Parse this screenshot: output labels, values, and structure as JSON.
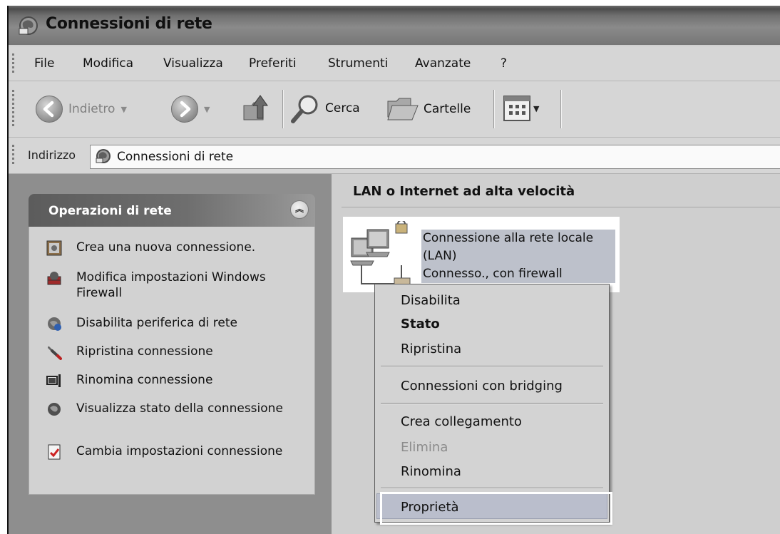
{
  "window": {
    "title": "Connessioni di rete"
  },
  "menubar": {
    "items": [
      "File",
      "Modifica",
      "Visualizza",
      "Preferiti",
      "Strumenti",
      "Avanzate",
      "?"
    ]
  },
  "toolbar": {
    "back_label": "Indietro",
    "search_label": "Cerca",
    "folders_label": "Cartelle"
  },
  "address": {
    "label": "Indirizzo",
    "value": "Connessioni di rete"
  },
  "tasks_panel": {
    "title": "Operazioni di rete",
    "items": [
      {
        "label": "Crea una nuova connessione."
      },
      {
        "label": "Modifica impostazioni Windows Firewall"
      },
      {
        "label": "Disabilita periferica di rete"
      },
      {
        "label": "Ripristina connessione"
      },
      {
        "label": "Rinomina connessione"
      },
      {
        "label": "Visualizza stato della connessione"
      },
      {
        "label": "Cambia impostazioni connessione"
      }
    ]
  },
  "content": {
    "group_title": "LAN o Internet ad alta velocità",
    "connection": {
      "name_line1": "Connessione alla rete locale",
      "name_line2": "(LAN)",
      "status": "Connesso., con firewall"
    }
  },
  "context_menu": {
    "items": [
      {
        "label": "Disabilita"
      },
      {
        "label": "Stato"
      },
      {
        "label": "Ripristina"
      },
      {
        "label": "Connessioni con bridging"
      },
      {
        "label": "Crea collegamento"
      },
      {
        "label": "Elimina"
      },
      {
        "label": "Rinomina"
      },
      {
        "label": "Proprietà"
      }
    ]
  },
  "colors": {
    "selection": "#bdc1cb",
    "panel_header": "#5c5c5c",
    "left_pane": "#8e8e8e",
    "highlight_frame": "#ffffff"
  }
}
